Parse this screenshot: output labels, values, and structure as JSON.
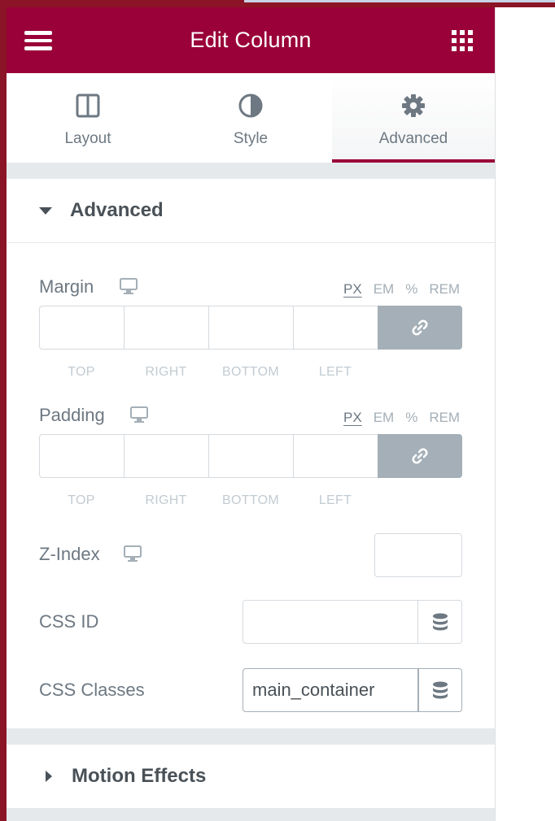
{
  "header": {
    "title": "Edit Column",
    "menu_icon": "hamburger-menu-icon",
    "grid_icon": "widgets-grid-icon"
  },
  "tabs": [
    {
      "label": "Layout",
      "icon": "columns-layout-icon",
      "active": false
    },
    {
      "label": "Style",
      "icon": "half-circle-contrast-icon",
      "active": false
    },
    {
      "label": "Advanced",
      "icon": "gear-icon",
      "active": true
    }
  ],
  "advanced_section": {
    "title": "Advanced",
    "expanded": true,
    "margin": {
      "label": "Margin",
      "units": [
        "PX",
        "EM",
        "%",
        "REM"
      ],
      "active_unit": "PX",
      "values": {
        "top": "",
        "right": "",
        "bottom": "",
        "left": ""
      },
      "sides": [
        "TOP",
        "RIGHT",
        "BOTTOM",
        "LEFT"
      ]
    },
    "padding": {
      "label": "Padding",
      "units": [
        "PX",
        "EM",
        "%",
        "REM"
      ],
      "active_unit": "PX",
      "values": {
        "top": "",
        "right": "",
        "bottom": "",
        "left": ""
      },
      "sides": [
        "TOP",
        "RIGHT",
        "BOTTOM",
        "LEFT"
      ]
    },
    "z_index": {
      "label": "Z-Index",
      "value": ""
    },
    "css_id": {
      "label": "CSS ID",
      "value": ""
    },
    "css_classes": {
      "label": "CSS Classes",
      "value": "main_container"
    }
  },
  "motion_section": {
    "title": "Motion Effects",
    "expanded": false
  },
  "colors": {
    "header_bg": "#9a0138",
    "frame": "#8b1526",
    "link_button": "#a4afb7",
    "text": "#6d7882",
    "heading": "#495157"
  }
}
